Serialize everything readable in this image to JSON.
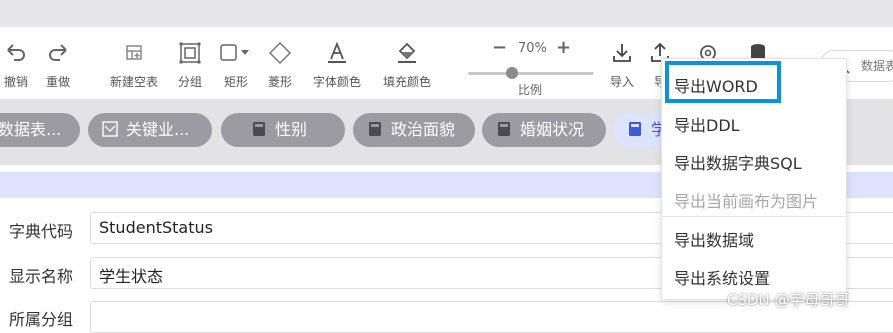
{
  "toolbar": {
    "items": [
      {
        "label": "撤销",
        "icon": "undo-icon"
      },
      {
        "label": "重做",
        "icon": "redo-icon"
      },
      {
        "label": "新建空表",
        "icon": "new-table-icon"
      },
      {
        "label": "分组",
        "icon": "group-icon"
      },
      {
        "label": "矩形",
        "icon": "rectangle-icon"
      },
      {
        "label": "菱形",
        "icon": "diamond-icon"
      },
      {
        "label": "字体颜色",
        "icon": "font-color-icon"
      },
      {
        "label": "填充颜色",
        "icon": "fill-color-icon"
      }
    ],
    "zoom": {
      "value": "70%",
      "label": "比例",
      "minus": "−",
      "plus": "+"
    },
    "import_label": "导入",
    "export_label": "导",
    "search_text": "数据表"
  },
  "tags": [
    {
      "label": "数据表...",
      "icon": "table-icon"
    },
    {
      "label": "关键业...",
      "icon": "diagram-icon"
    },
    {
      "label": "性别",
      "icon": "book-icon"
    },
    {
      "label": "政治面貌",
      "icon": "book-icon"
    },
    {
      "label": "婚姻状况",
      "icon": "book-icon"
    },
    {
      "label": "学",
      "icon": "book-icon"
    }
  ],
  "form": {
    "fields": [
      {
        "label": "字典代码",
        "value": "StudentStatus"
      },
      {
        "label": "显示名称",
        "value": "学生状态"
      },
      {
        "label": "所属分组",
        "value": ""
      }
    ]
  },
  "export_menu": {
    "items": [
      {
        "label": "导出WORD",
        "disabled": false
      },
      {
        "label": "导出DDL",
        "disabled": false
      },
      {
        "label": "导出数据字典SQL",
        "disabled": false
      },
      {
        "label": "导出当前画布为图片",
        "disabled": true
      },
      {
        "label": "导出数据域",
        "disabled": false
      },
      {
        "label": "导出系统设置",
        "disabled": false
      }
    ]
  },
  "watermark": "CSDN @字母哥哥",
  "colors": {
    "highlight": "#0b94dd",
    "tag_bg": "#9b9ba1",
    "tag_active_bg": "#dde4ff",
    "band": "#dde3ff"
  }
}
